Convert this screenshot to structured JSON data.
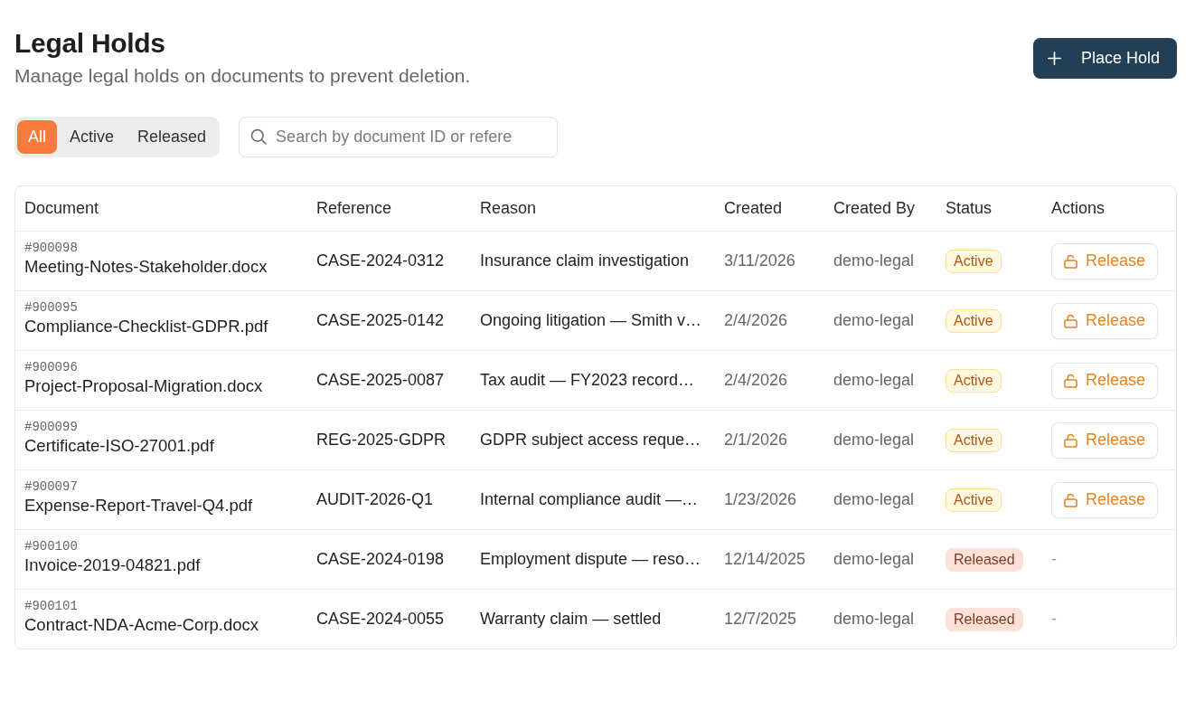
{
  "page": {
    "title": "Legal Holds",
    "subtitle": "Manage legal holds on documents to prevent deletion."
  },
  "primary_button": {
    "label": "Place Hold"
  },
  "filters": [
    {
      "label": "All",
      "selected": true
    },
    {
      "label": "Active",
      "selected": false
    },
    {
      "label": "Released",
      "selected": false
    }
  ],
  "search": {
    "placeholder": "Search by document ID or refere"
  },
  "table": {
    "columns": [
      "Document",
      "Reference",
      "Reason",
      "Created",
      "Created By",
      "Status",
      "Actions"
    ],
    "rows": [
      {
        "document_id": "#900098",
        "document": "Meeting-Notes-Stakeholder.docx",
        "reference": "CASE-2024-0312",
        "reason": "Insurance claim investigation",
        "created": "3/11/2026",
        "created_by": "demo-legal",
        "status": {
          "label": "Active",
          "kind": "active"
        },
        "action": {
          "kind": "button",
          "label": "Release"
        }
      },
      {
        "document_id": "#900095",
        "document": "Compliance-Checklist-GDPR.pdf",
        "reference": "CASE-2025-0142",
        "reason": "Ongoing litigation — Smith v…",
        "created": "2/4/2026",
        "created_by": "demo-legal",
        "status": {
          "label": "Active",
          "kind": "active"
        },
        "action": {
          "kind": "button",
          "label": "Release"
        }
      },
      {
        "document_id": "#900096",
        "document": "Project-Proposal-Migration.docx",
        "reference": "CASE-2025-0087",
        "reason": "Tax audit — FY2023 record…",
        "created": "2/4/2026",
        "created_by": "demo-legal",
        "status": {
          "label": "Active",
          "kind": "active"
        },
        "action": {
          "kind": "button",
          "label": "Release"
        }
      },
      {
        "document_id": "#900099",
        "document": "Certificate-ISO-27001.pdf",
        "reference": "REG-2025-GDPR",
        "reason": "GDPR subject access reque…",
        "created": "2/1/2026",
        "created_by": "demo-legal",
        "status": {
          "label": "Active",
          "kind": "active"
        },
        "action": {
          "kind": "button",
          "label": "Release"
        }
      },
      {
        "document_id": "#900097",
        "document": "Expense-Report-Travel-Q4.pdf",
        "reference": "AUDIT-2026-Q1",
        "reason": "Internal compliance audit —…",
        "created": "1/23/2026",
        "created_by": "demo-legal",
        "status": {
          "label": "Active",
          "kind": "active"
        },
        "action": {
          "kind": "button",
          "label": "Release"
        }
      },
      {
        "document_id": "#900100",
        "document": "Invoice-2019-04821.pdf",
        "reference": "CASE-2024-0198",
        "reason": "Employment dispute — reso…",
        "created": "12/14/2025",
        "created_by": "demo-legal",
        "status": {
          "label": "Released",
          "kind": "released"
        },
        "action": {
          "kind": "none",
          "label": "-"
        }
      },
      {
        "document_id": "#900101",
        "document": "Contract-NDA-Acme-Corp.docx",
        "reference": "CASE-2024-0055",
        "reason": "Warranty claim — settled",
        "created": "12/7/2025",
        "created_by": "demo-legal",
        "status": {
          "label": "Released",
          "kind": "released"
        },
        "action": {
          "kind": "none",
          "label": "-"
        }
      }
    ]
  }
}
